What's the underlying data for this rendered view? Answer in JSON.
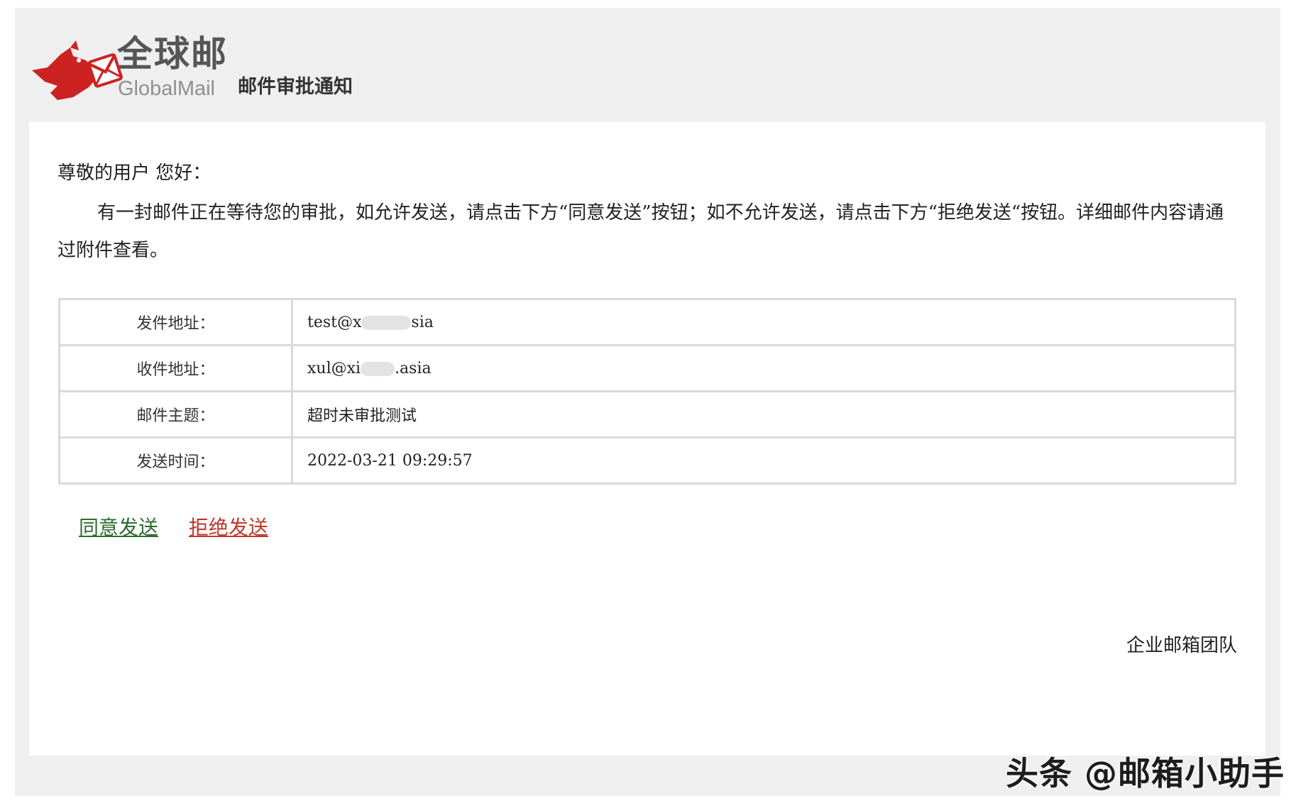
{
  "header": {
    "logo_cn": "全球邮",
    "logo_en": "GlobalMail",
    "title": "邮件审批通知"
  },
  "body": {
    "greeting": "尊敬的用户 您好：",
    "intro": "有一封邮件正在等待您的审批，如允许发送，请点击下方“同意发送”按钮；如不允许发送，请点击下方“拒绝发送“按钮。详细邮件内容请通过附件查看。"
  },
  "details": {
    "rows": [
      {
        "label": "发件地址：",
        "value_start": "test@x",
        "value_end": "sia"
      },
      {
        "label": "收件地址：",
        "value_start": "xul@xi",
        "value_end": ".asia"
      },
      {
        "label": "邮件主题：",
        "value": "超时未审批测试"
      },
      {
        "label": "发送时间：",
        "value": "2022-03-21 09:29:57"
      }
    ]
  },
  "actions": {
    "approve_label": "同意发送",
    "reject_label": "拒绝发送"
  },
  "signature": "企业邮箱团队",
  "watermark": "头条 @邮箱小助手",
  "colors": {
    "approve": "#2f6b2f",
    "reject": "#c0392b",
    "logo_red": "#cc2222",
    "frame_bg": "#efefef"
  }
}
